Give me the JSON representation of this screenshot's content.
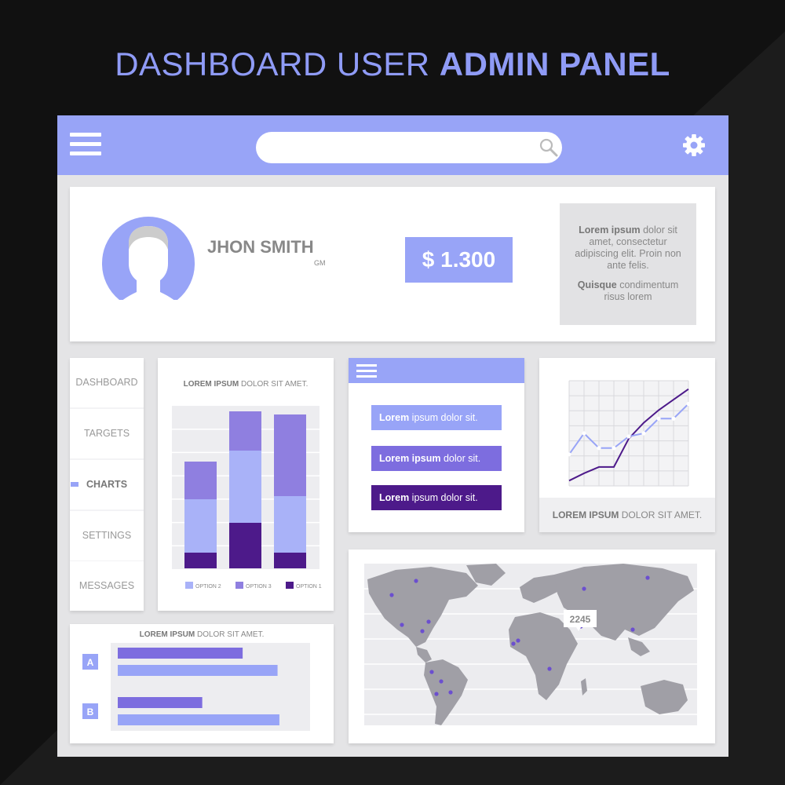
{
  "title": {
    "light": "DASHBOARD USER ",
    "bold": "ADMIN PANEL"
  },
  "colors": {
    "accent": "#98a4f7",
    "accent_mid": "#7d6ddf",
    "accent_dark": "#4d1a8a",
    "panel": "#e4e4e6",
    "background": "#111111"
  },
  "topbar": {
    "menu_icon": "hamburger-icon",
    "search_placeholder": "",
    "search_icon": "search-icon",
    "settings_icon": "gear-icon"
  },
  "profile": {
    "name": "JHON SMITH",
    "role": "GM",
    "amount": "$ 1.300",
    "note": {
      "p1_bold": "Lorem ipsum",
      "p1_rest": " dolor sit amet, consectetur adipiscing elit. Proin non ante felis.",
      "p2_bold": "Quisque",
      "p2_rest": " condimentum risus lorem"
    }
  },
  "sidebar": {
    "items": [
      {
        "label": "DASHBOARD"
      },
      {
        "label": "TARGETS"
      },
      {
        "label": "CHARTS"
      },
      {
        "label": "SETTINGS"
      },
      {
        "label": "MESSAGES"
      }
    ],
    "active": "CHARTS"
  },
  "bar_card": {
    "heading_bold": "LOREM IPSUM",
    "heading_rest": " DOLOR SIT AMET."
  },
  "menu_card": {
    "items": [
      {
        "bold": "Lorem",
        "rest": " ipsum dolor sit.",
        "color": "#98a4f7"
      },
      {
        "bold": "Lorem ipsum",
        "rest": " dolor sit.",
        "color": "#7d6ddf"
      },
      {
        "bold": "Lorem",
        "rest": " ipsum dolor sit.",
        "color": "#4d1a8a"
      }
    ]
  },
  "line_card": {
    "caption_bold": "LOREM IPSUM",
    "caption_rest": " DOLOR SIT AMET."
  },
  "hbar_card": {
    "heading_bold": "LOREM IPSUM",
    "heading_rest": " DOLOR SIT AMET."
  },
  "map_card": {
    "callout": "2245"
  },
  "chart_data": [
    {
      "type": "bar",
      "stacked": true,
      "categories": [
        "",
        "",
        ""
      ],
      "series": [
        {
          "name": "OPTION 1",
          "color": "#4d1a8a",
          "values": [
            10,
            29,
            10
          ]
        },
        {
          "name": "OPTION 2",
          "color": "#a9b2f8",
          "values": [
            34,
            46,
            36
          ]
        },
        {
          "name": "OPTION 3",
          "color": "#8f7fe0",
          "values": [
            24,
            25,
            52
          ]
        }
      ],
      "ylim": [
        0,
        100
      ],
      "grid": true,
      "legend": "bottom"
    },
    {
      "type": "line",
      "x": [
        0,
        1,
        2,
        3,
        4,
        5,
        6,
        7,
        8
      ],
      "series": [
        {
          "color": "#4d1a8a",
          "values": [
            0.05,
            0.12,
            0.18,
            0.18,
            0.45,
            0.6,
            0.72,
            0.82,
            0.92
          ]
        },
        {
          "color": "#98a4f7",
          "values": [
            0.3,
            0.5,
            0.36,
            0.36,
            0.47,
            0.5,
            0.64,
            0.64,
            0.78
          ]
        }
      ],
      "grid": true
    },
    {
      "type": "bar",
      "orientation": "horizontal",
      "categories": [
        "A",
        "B"
      ],
      "series": [
        {
          "color": "#7d6ddf",
          "values": [
            0.68,
            0.46
          ]
        },
        {
          "color": "#98a4f7",
          "values": [
            0.87,
            0.88
          ]
        }
      ],
      "xlim": [
        0,
        1
      ]
    }
  ]
}
